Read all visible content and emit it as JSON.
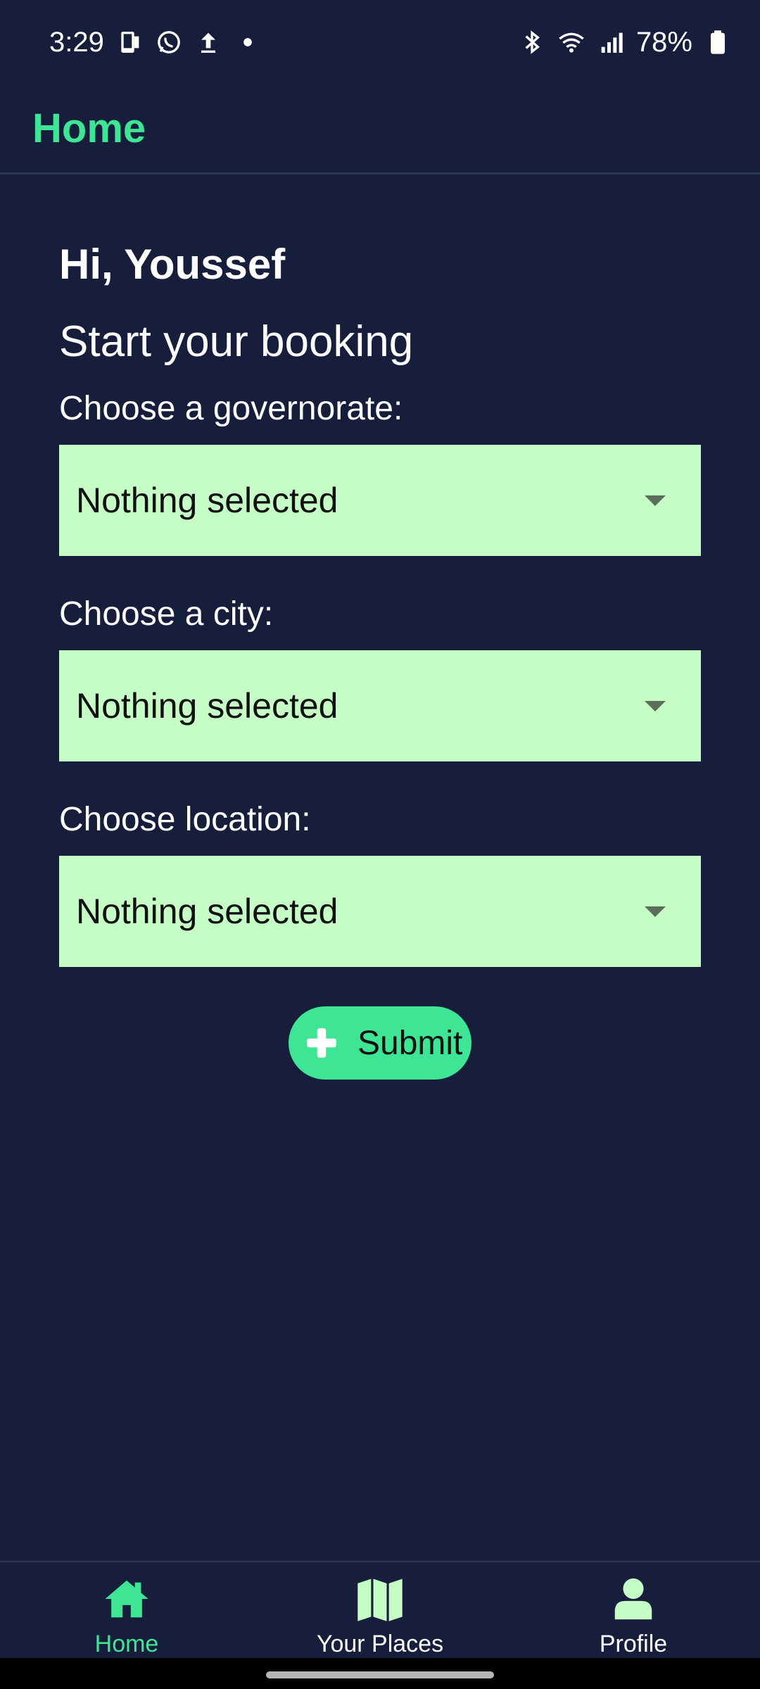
{
  "status_bar": {
    "time": "3:29",
    "battery": "78%",
    "left_icons": [
      "phone-screen-icon",
      "whatsapp-icon",
      "upload-icon",
      "dot-icon"
    ],
    "right_icons": [
      "bluetooth-icon",
      "wifi-icon",
      "signal-icon",
      "battery-icon"
    ]
  },
  "app_bar": {
    "title": "Home"
  },
  "main": {
    "greeting": "Hi, Youssef",
    "subtitle": "Start your booking",
    "fields": [
      {
        "label": "Choose a governorate:",
        "value": "Nothing selected"
      },
      {
        "label": "Choose a city:",
        "value": "Nothing selected"
      },
      {
        "label": "Choose location:",
        "value": "Nothing selected"
      }
    ],
    "submit_label": "Submit"
  },
  "bottom_nav": {
    "items": [
      {
        "label": "Home",
        "icon": "home-icon",
        "active": true
      },
      {
        "label": "Your Places",
        "icon": "map-icon",
        "active": false
      },
      {
        "label": "Profile",
        "icon": "person-icon",
        "active": false
      }
    ]
  },
  "colors": {
    "background": "#161e3c",
    "accent": "#3ee595",
    "select_background": "#c6fcc6",
    "nav_icon_light": "#c6fcc6"
  }
}
